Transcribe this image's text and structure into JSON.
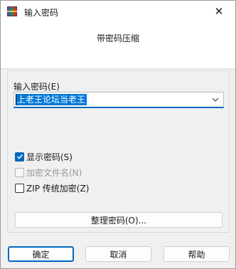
{
  "window": {
    "title": "输入密码",
    "close_glyph": "✕",
    "icon": "winrar-icon"
  },
  "header": {
    "subtitle": "带密码压缩"
  },
  "password": {
    "label": "输入密码(E)",
    "value": "上老王论坛当老王"
  },
  "options": {
    "show_password": {
      "label": "显示密码(S)",
      "checked": true,
      "enabled": true
    },
    "encrypt_filenames": {
      "label": "加密文件名(N)",
      "checked": false,
      "enabled": false
    },
    "zip_legacy": {
      "label": "ZIP 传统加密(Z)",
      "checked": false,
      "enabled": true
    }
  },
  "buttons": {
    "organize": "整理密码(O)...",
    "ok": "确定",
    "cancel": "取消",
    "help": "帮助"
  },
  "colors": {
    "accent": "#0067c0",
    "selection": "#0078d7"
  }
}
